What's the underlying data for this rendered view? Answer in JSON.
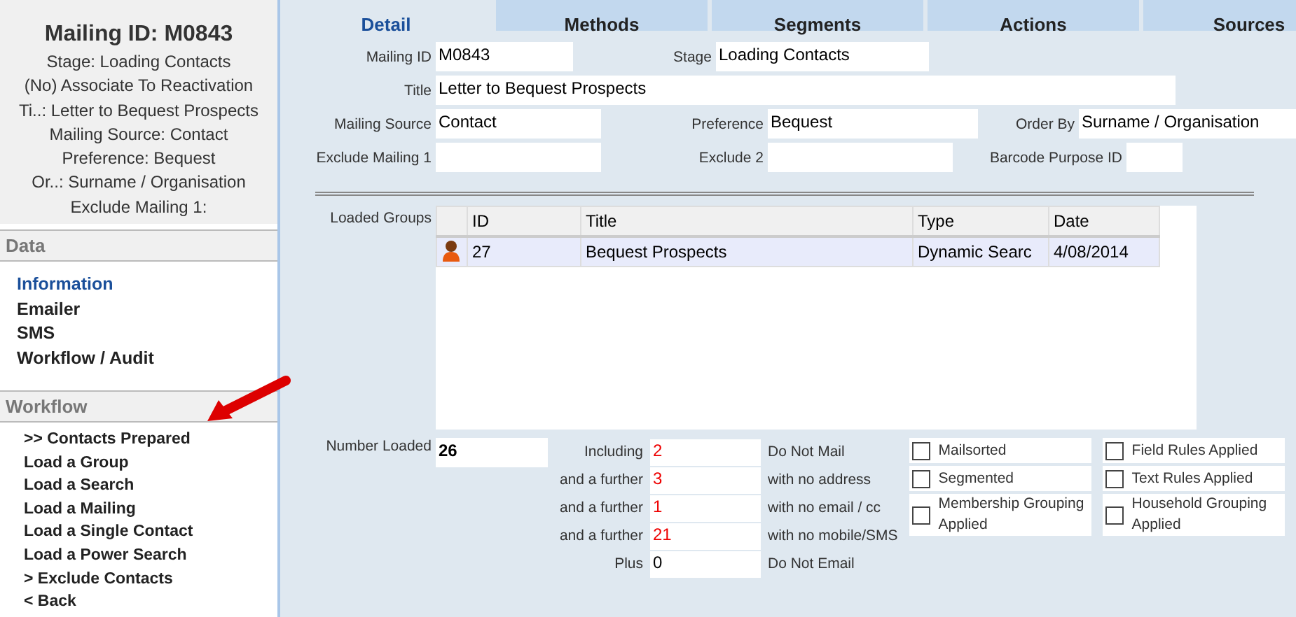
{
  "sidebar": {
    "title": "Mailing ID: M0843",
    "summary": [
      "Stage: Loading Contacts",
      "(No) Associate To Reactivation",
      "Ti..: Letter to Bequest Prospects",
      "Mailing Source: Contact",
      "Preference: Bequest",
      "Or..: Surname / Organisation",
      "Exclude Mailing 1:"
    ],
    "sections": [
      {
        "heading": "Data",
        "items": [
          {
            "label": "Information",
            "selected": true
          },
          {
            "label": "Emailer",
            "selected": false
          },
          {
            "label": "SMS",
            "selected": false
          },
          {
            "label": "Workflow / Audit",
            "selected": false
          }
        ]
      },
      {
        "heading": "Workflow",
        "items": [
          {
            "label": ">> Contacts Prepared",
            "selected": false
          },
          {
            "label": "Load a Group",
            "selected": false
          },
          {
            "label": "Load a Search",
            "selected": false
          },
          {
            "label": "Load a Mailing",
            "selected": false
          },
          {
            "label": "Load a Single Contact",
            "selected": false
          },
          {
            "label": "Load a Power Search",
            "selected": false
          },
          {
            "label": "> Exclude Contacts",
            "selected": false
          },
          {
            "label": "< Back",
            "selected": false
          }
        ]
      }
    ]
  },
  "tabs": [
    {
      "label": "Detail",
      "selected": true
    },
    {
      "label": "Methods",
      "selected": false
    },
    {
      "label": "Segments",
      "selected": false
    },
    {
      "label": "Actions",
      "selected": false
    },
    {
      "label": "Sources",
      "selected": false
    }
  ],
  "fields": {
    "mailing_id": {
      "label": "Mailing ID",
      "value": "M0843"
    },
    "stage": {
      "label": "Stage",
      "value": "Loading Contacts"
    },
    "title": {
      "label": "Title",
      "value": "Letter to Bequest Prospects"
    },
    "mailing_source": {
      "label": "Mailing Source",
      "value": "Contact"
    },
    "preference": {
      "label": "Preference",
      "value": "Bequest"
    },
    "order_by": {
      "label": "Order By",
      "value": "Surname / Organisation"
    },
    "exclude_1": {
      "label": "Exclude Mailing 1"
    },
    "exclude_2": {
      "label": "Exclude 2"
    },
    "barcode": {
      "label": "Barcode Purpose ID"
    }
  },
  "loaded_groups": {
    "label": "Loaded Groups",
    "columns": [
      "ID",
      "Title",
      "Type",
      "Date"
    ],
    "rows": [
      {
        "id": "27",
        "title": "Bequest Prospects",
        "type": "Dynamic Searc",
        "date": "4/08/2014",
        "selected": true
      }
    ]
  },
  "number_loaded": {
    "label": "Number Loaded",
    "value": "26"
  },
  "counts": [
    {
      "label": "Including",
      "value": "2",
      "highlight": true,
      "description": "Do Not Mail"
    },
    {
      "label": "and a further",
      "value": "3",
      "highlight": true,
      "description": "with no address"
    },
    {
      "label": "and a further",
      "value": "1",
      "highlight": true,
      "description": "with no email / cc"
    },
    {
      "label": "and a further",
      "value": "21",
      "highlight": true,
      "description": "with no mobile/SMS"
    },
    {
      "label": "Plus",
      "value": "0",
      "highlight": false,
      "description": "Do Not Email"
    }
  ],
  "checks": [
    {
      "label": "Mailsorted",
      "checked": false
    },
    {
      "label": "Field Rules Applied",
      "checked": false
    },
    {
      "label": "Segmented",
      "checked": false
    },
    {
      "label": "Text Rules Applied",
      "checked": false
    },
    {
      "label": "Membership Grouping Applied",
      "checked": false
    },
    {
      "label": "Household Grouping Applied",
      "checked": false
    }
  ]
}
